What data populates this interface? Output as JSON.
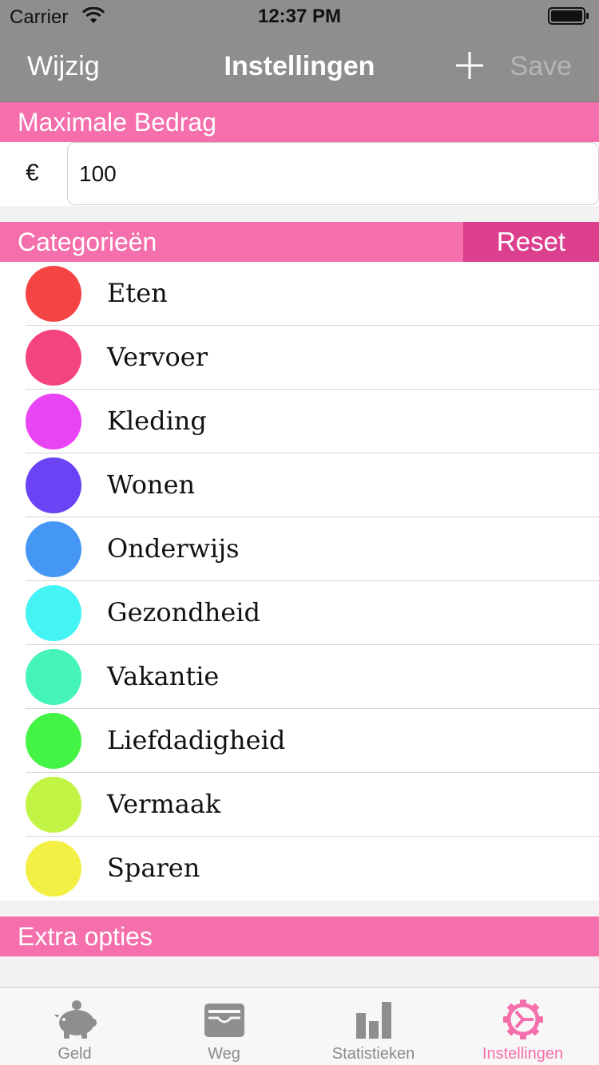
{
  "status_bar": {
    "carrier": "Carrier",
    "time": "12:37 PM"
  },
  "nav": {
    "left_label": "Wijzig",
    "title": "Instellingen",
    "save_label": "Save"
  },
  "max_amount": {
    "header": "Maximale Bedrag",
    "currency_symbol": "€",
    "value": "100"
  },
  "categories": {
    "header": "Categorieën",
    "reset_label": "Reset",
    "items": [
      {
        "name": "Eten",
        "color": "#f44444"
      },
      {
        "name": "Vervoer",
        "color": "#f4447e"
      },
      {
        "name": "Kleding",
        "color": "#e944f4"
      },
      {
        "name": "Wonen",
        "color": "#6a44f4"
      },
      {
        "name": "Onderwijs",
        "color": "#4497f4"
      },
      {
        "name": "Gezondheid",
        "color": "#44f4f4"
      },
      {
        "name": "Vakantie",
        "color": "#44f4b9"
      },
      {
        "name": "Liefdadigheid",
        "color": "#44f444"
      },
      {
        "name": "Vermaak",
        "color": "#c1f444"
      },
      {
        "name": "Sparen",
        "color": "#f4ef44"
      }
    ]
  },
  "extra": {
    "header": "Extra opties"
  },
  "tabbar": {
    "tabs": [
      {
        "label": "Geld",
        "icon": "piggy-bank-icon"
      },
      {
        "label": "Weg",
        "icon": "wallet-icon"
      },
      {
        "label": "Statistieken",
        "icon": "bar-chart-icon"
      },
      {
        "label": "Instellingen",
        "icon": "gear-icon"
      }
    ],
    "active_color": "#f46fab"
  },
  "colors": {
    "bar_gray": "#8e8e8e",
    "pink": "#f46fab",
    "reset_pink": "#dc3f8e"
  }
}
